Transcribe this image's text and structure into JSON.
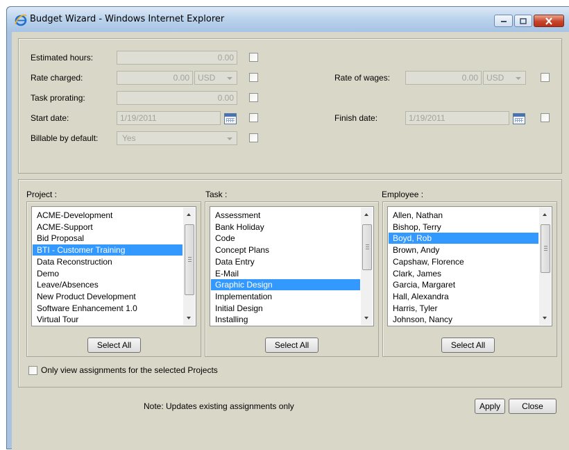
{
  "window": {
    "title": "Budget Wizard - Windows Internet Explorer"
  },
  "top_fields": {
    "estimated_hours": {
      "label": "Estimated hours:",
      "value": "0.00"
    },
    "rate_charged": {
      "label": "Rate charged:",
      "value": "0.00",
      "currency": "USD"
    },
    "rate_of_wages": {
      "label": "Rate of wages:",
      "value": "0.00",
      "currency": "USD"
    },
    "task_prorating": {
      "label": "Task prorating:",
      "value": "0.00"
    },
    "start_date": {
      "label": "Start date:",
      "value": "1/19/2011"
    },
    "finish_date": {
      "label": "Finish date:",
      "value": "1/19/2011"
    },
    "billable": {
      "label": "Billable by default:",
      "value": "Yes"
    }
  },
  "project": {
    "label": "Project :",
    "items": [
      "ACME-Development",
      "ACME-Support",
      "Bid Proposal",
      "BTI - Customer Training",
      "Data Reconstruction",
      "Demo",
      "Leave/Absences",
      "New Product Development",
      "Software Enhancement 1.0",
      "Virtual Tour"
    ],
    "selected_index": 3,
    "select_all": "Select All"
  },
  "task": {
    "label": "Task :",
    "items": [
      "Assessment",
      "Bank Holiday",
      "Code",
      "Concept Plans",
      "Data Entry",
      "E-Mail",
      "Graphic Design",
      "Implementation",
      "Initial Design",
      "Installing"
    ],
    "selected_index": 6,
    "select_all": "Select All"
  },
  "employee": {
    "label": "Employee :",
    "items": [
      "Allen, Nathan",
      "Bishop, Terry",
      "Boyd, Rob",
      "Brown, Andy",
      "Capshaw, Florence",
      "Clark, James",
      "Garcia, Margaret",
      "Hall, Alexandra",
      "Harris, Tyler",
      "Johnson, Nancy"
    ],
    "selected_index": 2,
    "select_all": "Select All"
  },
  "only_view_label": "Only view assignments for the selected Projects",
  "note": "Note: Updates existing assignments only",
  "buttons": {
    "apply": "Apply",
    "close": "Close"
  },
  "colors": {
    "selection": "#3399ff",
    "panel": "#d9d7c8",
    "frame": "#a9c4e2"
  }
}
